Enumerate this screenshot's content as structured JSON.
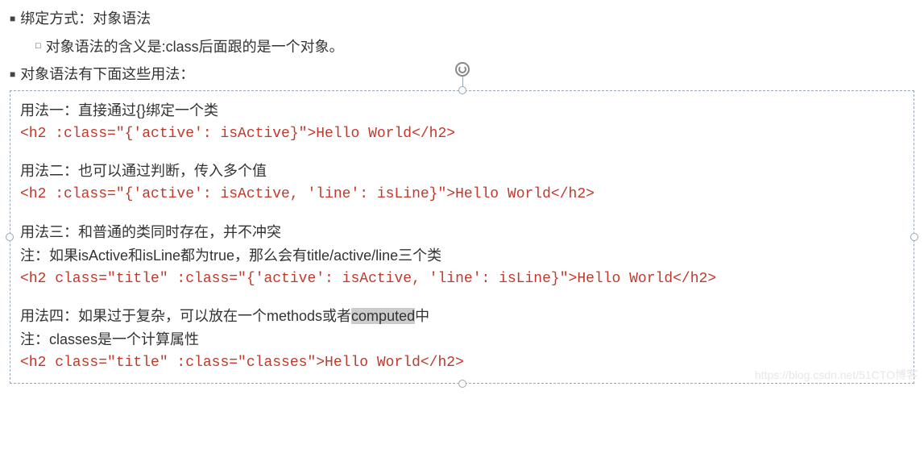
{
  "bullets": {
    "b1": "绑定方式：对象语法",
    "b1_sub": "对象语法的含义是:class后面跟的是一个对象。",
    "b2": "对象语法有下面这些用法："
  },
  "code": {
    "u1_desc": "用法一：直接通过{}绑定一个类",
    "u1_code": "<h2 :class=\"{'active': isActive}\">Hello World</h2>",
    "u2_desc": "用法二：也可以通过判断，传入多个值",
    "u2_code": "<h2 :class=\"{'active': isActive, 'line': isLine}\">Hello World</h2>",
    "u3_desc": "用法三：和普通的类同时存在，并不冲突",
    "u3_note": "注：如果isActive和isLine都为true，那么会有title/active/line三个类",
    "u3_code": "<h2 class=\"title\" :class=\"{'active': isActive, 'line': isLine}\">Hello World</h2>",
    "u4_desc_pre": "用法四：如果过于复杂，可以放在一个methods或者",
    "u4_desc_hl": "computed",
    "u4_desc_post": "中",
    "u4_note": "注：classes是一个计算属性",
    "u4_code": "<h2 class=\"title\" :class=\"classes\">Hello World</h2>"
  },
  "watermark": "https://blog.csdn.net/51CTO博客"
}
